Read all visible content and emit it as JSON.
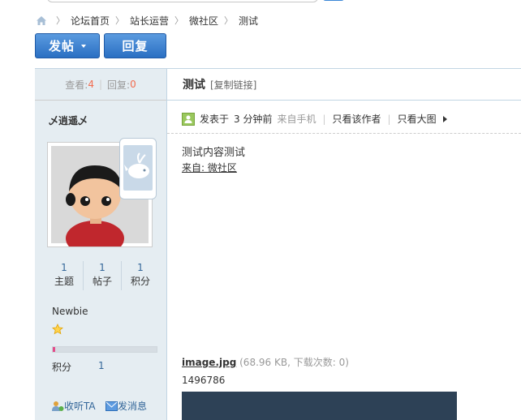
{
  "breadcrumb": [
    "论坛首页",
    "站长运营",
    "微社区",
    "测试"
  ],
  "buttons": {
    "post": "发帖",
    "reply": "回复"
  },
  "stats": {
    "views_label": "查看:",
    "views": "4",
    "replies_label": "回复:",
    "replies": "0"
  },
  "thread": {
    "title": "测试",
    "copy_link": "[复制链接]"
  },
  "author": {
    "name": "乄逍遥乄",
    "counts": [
      {
        "value": "1",
        "label": "主题"
      },
      {
        "value": "1",
        "label": "帖子"
      },
      {
        "value": "1",
        "label": "积分"
      }
    ],
    "rank": "Newbie",
    "progress": 0.02,
    "score_label": "积分",
    "score_value": "1",
    "actions": {
      "follow": "收听TA",
      "message": "发消息"
    }
  },
  "post": {
    "posted": "发表于",
    "time": "3 分钟前",
    "source": "来自手机",
    "only_author": "只看该作者",
    "only_big_image": "只看大图",
    "content": "测试内容测试",
    "from_link": "来自: 微社区"
  },
  "attachment": {
    "filename": "image.jpg",
    "info": "(68.96 KB, 下载次数: 0)",
    "id": "1496786"
  },
  "colors": {
    "accent": "#2a6fc2",
    "sidebar": "#e5edf2",
    "count": "#f26c4f",
    "link": "#336699"
  }
}
